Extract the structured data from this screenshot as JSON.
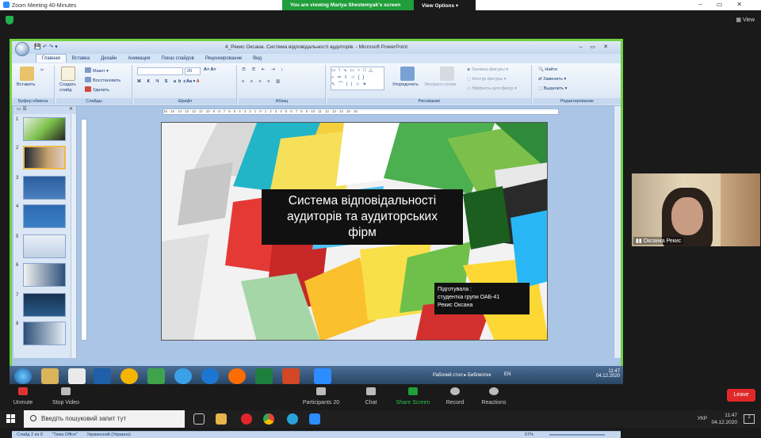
{
  "zoom": {
    "window_title": "Zoom Meeting 40-Minutes",
    "banner_text": "You are viewing Mariya Shestemyak's screen",
    "view_options_label": "View Options",
    "view_label": "View",
    "controls": {
      "unmute": "Unmute",
      "stop_video": "Stop Video",
      "participants": "Participants",
      "participants_count": "20",
      "chat": "Chat",
      "share_screen": "Share Screen",
      "record": "Record",
      "reactions": "Reactions",
      "leave": "Leave"
    },
    "participant": {
      "name": "Оксанка Рекис"
    }
  },
  "powerpoint": {
    "title": "4_Рекис Оксана. Система відповідальності аудиторів. - Microsoft PowerPoint",
    "tabs": [
      "Главная",
      "Вставка",
      "Дизайн",
      "Анимация",
      "Показ слайдов",
      "Рецензирование",
      "Вид"
    ],
    "ribbon": {
      "paste": "Вставить",
      "clipboard_group": "Буфер обмена",
      "new_slide": "Создать слайд",
      "layout": "Макет",
      "reset": "Восстановить",
      "delete": "Удалить",
      "slides_group": "Слайды",
      "font_size": "20",
      "font_group": "Шрифт",
      "paragraph_group": "Абзац",
      "arrange": "Упорядочить",
      "quick_styles": "Экспресс-стили",
      "shape_fill": "Заливка фигуры",
      "shape_outline": "Контур фигуры",
      "shape_effects": "Эффекты для фигур",
      "drawing_group": "Рисование",
      "find": "Найти",
      "replace": "Заменить",
      "select": "Выделить",
      "editing_group": "Редактирование"
    },
    "ruler_text": "16 · 15 · 14 · 13 · 12 · 11 · 10 · 9 · 8 · 7 · 6 · 5 · 4 · 3 · 2 · 1 · 0 · 1 · 2 · 3 · 4 · 5 · 6 · 7 · 8 · 9 · 10 · 11 · 12 · 13 · 14 · 15 · 16",
    "thumbnails": [
      "1",
      "2",
      "3",
      "4",
      "5",
      "6",
      "7",
      "8"
    ],
    "slide": {
      "title_line1": "Система відповідальності",
      "title_line2": "аудиторів та аудиторських",
      "title_line3": "фірм",
      "author_line1": "Підготувала :",
      "author_line2": "студентка групи ОАБ-41",
      "author_line3": "Рекис Оксана"
    },
    "status": {
      "slide_of": "Слайд 2 из 9",
      "theme": "\"Тема Office\"",
      "language": "Украинский (Украина)",
      "zoom": "67%"
    }
  },
  "remote_taskbar": {
    "desktop_label": "Рабочий стол",
    "libraries_label": "Библиотек",
    "lang": "EN",
    "time": "11:47",
    "date": "04.12.2020"
  },
  "windows": {
    "search_placeholder": "Введіть пошуковий запит тут",
    "lang": "УКР",
    "time": "11:47",
    "date": "04.12.2020",
    "notification_count": "2"
  }
}
